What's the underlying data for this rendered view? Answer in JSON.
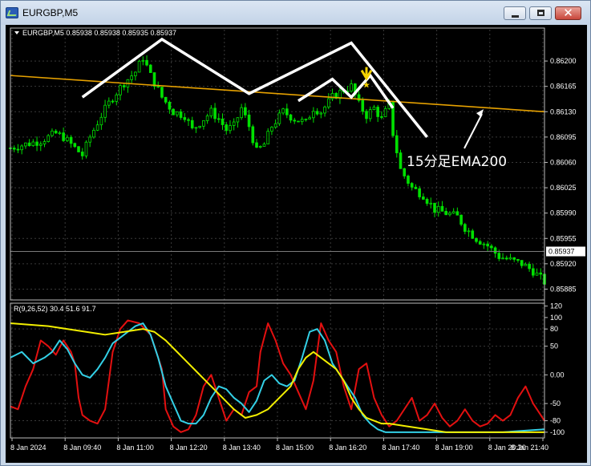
{
  "window": {
    "title": "EURGBP,M5"
  },
  "colors": {
    "background": "#000000",
    "candle": "#00e000",
    "ema": "#e6a100",
    "grid": "#3a3a3a",
    "line_red": "#e31010",
    "line_cyan": "#33d0e6",
    "line_yellow": "#f2ee00",
    "annotation": "#ffffff",
    "arrow_marker": "#f2d100"
  },
  "chart_data": [
    {
      "type": "candlestick",
      "header": "EURGBP,M5  0.85938 0.85938 0.85935 0.85937",
      "symbol": "EURGBP,M5",
      "y_ticks": [
        "0.86200",
        "0.86165",
        "0.86130",
        "0.86095",
        "0.86060",
        "0.86025",
        "0.85990",
        "0.85955",
        "0.85920",
        "0.85885"
      ],
      "ylim": [
        0.8587,
        0.8623
      ],
      "current_price": "0.85937",
      "x_ticks": [
        "8 Jan 2024",
        "8 Jan 09:40",
        "8 Jan 11:00",
        "8 Jan 12:20",
        "8 Jan 13:40",
        "8 Jan 15:00",
        "8 Jan 16:20",
        "8 Jan 17:40",
        "8 Jan 19:00",
        "8 Jan 20:20",
        "8 Jan 21:40"
      ],
      "close_path": [
        [
          0,
          0.8608
        ],
        [
          4,
          0.86085
        ],
        [
          8,
          0.8609
        ],
        [
          12,
          0.861
        ],
        [
          14,
          0.86095
        ],
        [
          17,
          0.8608
        ],
        [
          19,
          0.8607
        ],
        [
          21,
          0.86095
        ],
        [
          24,
          0.86125
        ],
        [
          27,
          0.8615
        ],
        [
          30,
          0.8617
        ],
        [
          33,
          0.86185
        ],
        [
          35,
          0.86205
        ],
        [
          37,
          0.8618
        ],
        [
          40,
          0.8615
        ],
        [
          43,
          0.8613
        ],
        [
          46,
          0.86125
        ],
        [
          48,
          0.86105
        ],
        [
          50,
          0.86115
        ],
        [
          53,
          0.8613
        ],
        [
          55,
          0.8612
        ],
        [
          57,
          0.86105
        ],
        [
          59,
          0.8611
        ],
        [
          61,
          0.86135
        ],
        [
          63,
          0.8611
        ],
        [
          65,
          0.86075
        ],
        [
          67,
          0.86085
        ],
        [
          69,
          0.8611
        ],
        [
          72,
          0.8613
        ],
        [
          75,
          0.8612
        ],
        [
          78,
          0.86115
        ],
        [
          80,
          0.86135
        ],
        [
          82,
          0.8613
        ],
        [
          85,
          0.8615
        ],
        [
          88,
          0.8616
        ],
        [
          90,
          0.86165
        ],
        [
          92,
          0.8614
        ],
        [
          94,
          0.86125
        ],
        [
          96,
          0.86135
        ],
        [
          98,
          0.8612
        ],
        [
          100,
          0.8614
        ],
        [
          101,
          0.861
        ],
        [
          103,
          0.8605
        ],
        [
          106,
          0.86025
        ],
        [
          109,
          0.86015
        ],
        [
          112,
          0.85995
        ],
        [
          115,
          0.8599
        ],
        [
          118,
          0.85985
        ],
        [
          120,
          0.8597
        ],
        [
          123,
          0.85955
        ],
        [
          126,
          0.85945
        ],
        [
          129,
          0.8593
        ],
        [
          132,
          0.85925
        ],
        [
          135,
          0.8592
        ],
        [
          138,
          0.8591
        ],
        [
          141,
          0.85895
        ]
      ],
      "ema_label": "15分足EMA200",
      "ema_line": [
        [
          0,
          0.8618
        ],
        [
          141,
          0.8613
        ]
      ],
      "annotation_lines": [
        [
          [
            19,
            0.8615
          ],
          [
            40,
            0.8623
          ],
          [
            63,
            0.86155
          ],
          [
            90,
            0.86225
          ],
          [
            110,
            0.86095
          ]
        ],
        [
          [
            76,
            0.86145
          ],
          [
            85,
            0.86175
          ],
          [
            90,
            0.8615
          ],
          [
            95,
            0.8618
          ],
          [
            101,
            0.86135
          ]
        ]
      ],
      "arrow_marker_at": [
        94,
        0.86165
      ]
    },
    {
      "type": "line",
      "header": "R(9,26,52) 30.4 51.6 91.7",
      "y_ticks": [
        "120",
        "100",
        "80",
        "50",
        "0.00",
        "-50",
        "-80",
        "-100"
      ],
      "ylim": [
        -110,
        125
      ],
      "series": [
        {
          "color": "#e31010",
          "values": [
            [
              0,
              -55
            ],
            [
              2,
              -60
            ],
            [
              4,
              -20
            ],
            [
              6,
              10
            ],
            [
              8,
              60
            ],
            [
              10,
              50
            ],
            [
              12,
              35
            ],
            [
              14,
              60
            ],
            [
              16,
              40
            ],
            [
              17,
              20
            ],
            [
              18,
              -40
            ],
            [
              19,
              -70
            ],
            [
              21,
              -80
            ],
            [
              23,
              -85
            ],
            [
              25,
              -60
            ],
            [
              27,
              40
            ],
            [
              29,
              80
            ],
            [
              31,
              95
            ],
            [
              34,
              90
            ],
            [
              37,
              70
            ],
            [
              40,
              10
            ],
            [
              41,
              -60
            ],
            [
              43,
              -90
            ],
            [
              45,
              -100
            ],
            [
              47,
              -95
            ],
            [
              49,
              -70
            ],
            [
              51,
              -20
            ],
            [
              53,
              0
            ],
            [
              55,
              -40
            ],
            [
              57,
              -80
            ],
            [
              59,
              -60
            ],
            [
              61,
              -70
            ],
            [
              63,
              -30
            ],
            [
              65,
              -20
            ],
            [
              66,
              40
            ],
            [
              68,
              90
            ],
            [
              70,
              60
            ],
            [
              72,
              20
            ],
            [
              74,
              0
            ],
            [
              76,
              -30
            ],
            [
              78,
              -60
            ],
            [
              80,
              -10
            ],
            [
              82,
              90
            ],
            [
              84,
              60
            ],
            [
              86,
              40
            ],
            [
              88,
              -20
            ],
            [
              90,
              -60
            ],
            [
              92,
              10
            ],
            [
              94,
              20
            ],
            [
              96,
              -40
            ],
            [
              98,
              -70
            ],
            [
              100,
              -90
            ],
            [
              102,
              -80
            ],
            [
              104,
              -60
            ],
            [
              106,
              -40
            ],
            [
              108,
              -80
            ],
            [
              110,
              -70
            ],
            [
              112,
              -50
            ],
            [
              114,
              -75
            ],
            [
              116,
              -90
            ],
            [
              118,
              -80
            ],
            [
              120,
              -60
            ],
            [
              122,
              -80
            ],
            [
              124,
              -90
            ],
            [
              126,
              -85
            ],
            [
              128,
              -70
            ],
            [
              130,
              -80
            ],
            [
              132,
              -70
            ],
            [
              134,
              -40
            ],
            [
              136,
              -20
            ],
            [
              138,
              -50
            ],
            [
              141,
              -80
            ]
          ]
        },
        {
          "color": "#33d0e6",
          "values": [
            [
              0,
              30
            ],
            [
              3,
              40
            ],
            [
              6,
              20
            ],
            [
              9,
              30
            ],
            [
              11,
              40
            ],
            [
              13,
              60
            ],
            [
              15,
              45
            ],
            [
              17,
              20
            ],
            [
              19,
              0
            ],
            [
              21,
              -5
            ],
            [
              23,
              10
            ],
            [
              25,
              30
            ],
            [
              27,
              55
            ],
            [
              29,
              65
            ],
            [
              31,
              75
            ],
            [
              33,
              85
            ],
            [
              35,
              90
            ],
            [
              37,
              70
            ],
            [
              39,
              30
            ],
            [
              41,
              -20
            ],
            [
              43,
              -50
            ],
            [
              45,
              -80
            ],
            [
              47,
              -85
            ],
            [
              49,
              -85
            ],
            [
              51,
              -70
            ],
            [
              53,
              -40
            ],
            [
              55,
              -20
            ],
            [
              57,
              -25
            ],
            [
              59,
              -40
            ],
            [
              61,
              -50
            ],
            [
              63,
              -65
            ],
            [
              65,
              -45
            ],
            [
              67,
              -10
            ],
            [
              69,
              0
            ],
            [
              71,
              -15
            ],
            [
              73,
              -20
            ],
            [
              75,
              -10
            ],
            [
              77,
              30
            ],
            [
              79,
              75
            ],
            [
              81,
              80
            ],
            [
              83,
              60
            ],
            [
              85,
              20
            ],
            [
              87,
              0
            ],
            [
              89,
              -20
            ],
            [
              91,
              -40
            ],
            [
              93,
              -70
            ],
            [
              95,
              -85
            ],
            [
              97,
              -95
            ],
            [
              99,
              -100
            ],
            [
              105,
              -100
            ],
            [
              110,
              -100
            ],
            [
              120,
              -100
            ],
            [
              130,
              -100
            ],
            [
              141,
              -95
            ]
          ]
        },
        {
          "color": "#f2ee00",
          "values": [
            [
              0,
              90
            ],
            [
              10,
              85
            ],
            [
              20,
              75
            ],
            [
              25,
              70
            ],
            [
              30,
              75
            ],
            [
              35,
              80
            ],
            [
              38,
              75
            ],
            [
              41,
              60
            ],
            [
              44,
              40
            ],
            [
              47,
              20
            ],
            [
              50,
              0
            ],
            [
              53,
              -20
            ],
            [
              56,
              -40
            ],
            [
              59,
              -60
            ],
            [
              62,
              -75
            ],
            [
              65,
              -70
            ],
            [
              68,
              -60
            ],
            [
              71,
              -40
            ],
            [
              74,
              -20
            ],
            [
              76,
              10
            ],
            [
              78,
              30
            ],
            [
              80,
              40
            ],
            [
              82,
              30
            ],
            [
              84,
              20
            ],
            [
              86,
              10
            ],
            [
              88,
              -10
            ],
            [
              90,
              -40
            ],
            [
              92,
              -60
            ],
            [
              94,
              -75
            ],
            [
              96,
              -80
            ],
            [
              98,
              -85
            ],
            [
              100,
              -85
            ],
            [
              105,
              -90
            ],
            [
              110,
              -95
            ],
            [
              115,
              -100
            ],
            [
              120,
              -100
            ],
            [
              130,
              -100
            ],
            [
              141,
              -100
            ]
          ]
        }
      ]
    }
  ]
}
